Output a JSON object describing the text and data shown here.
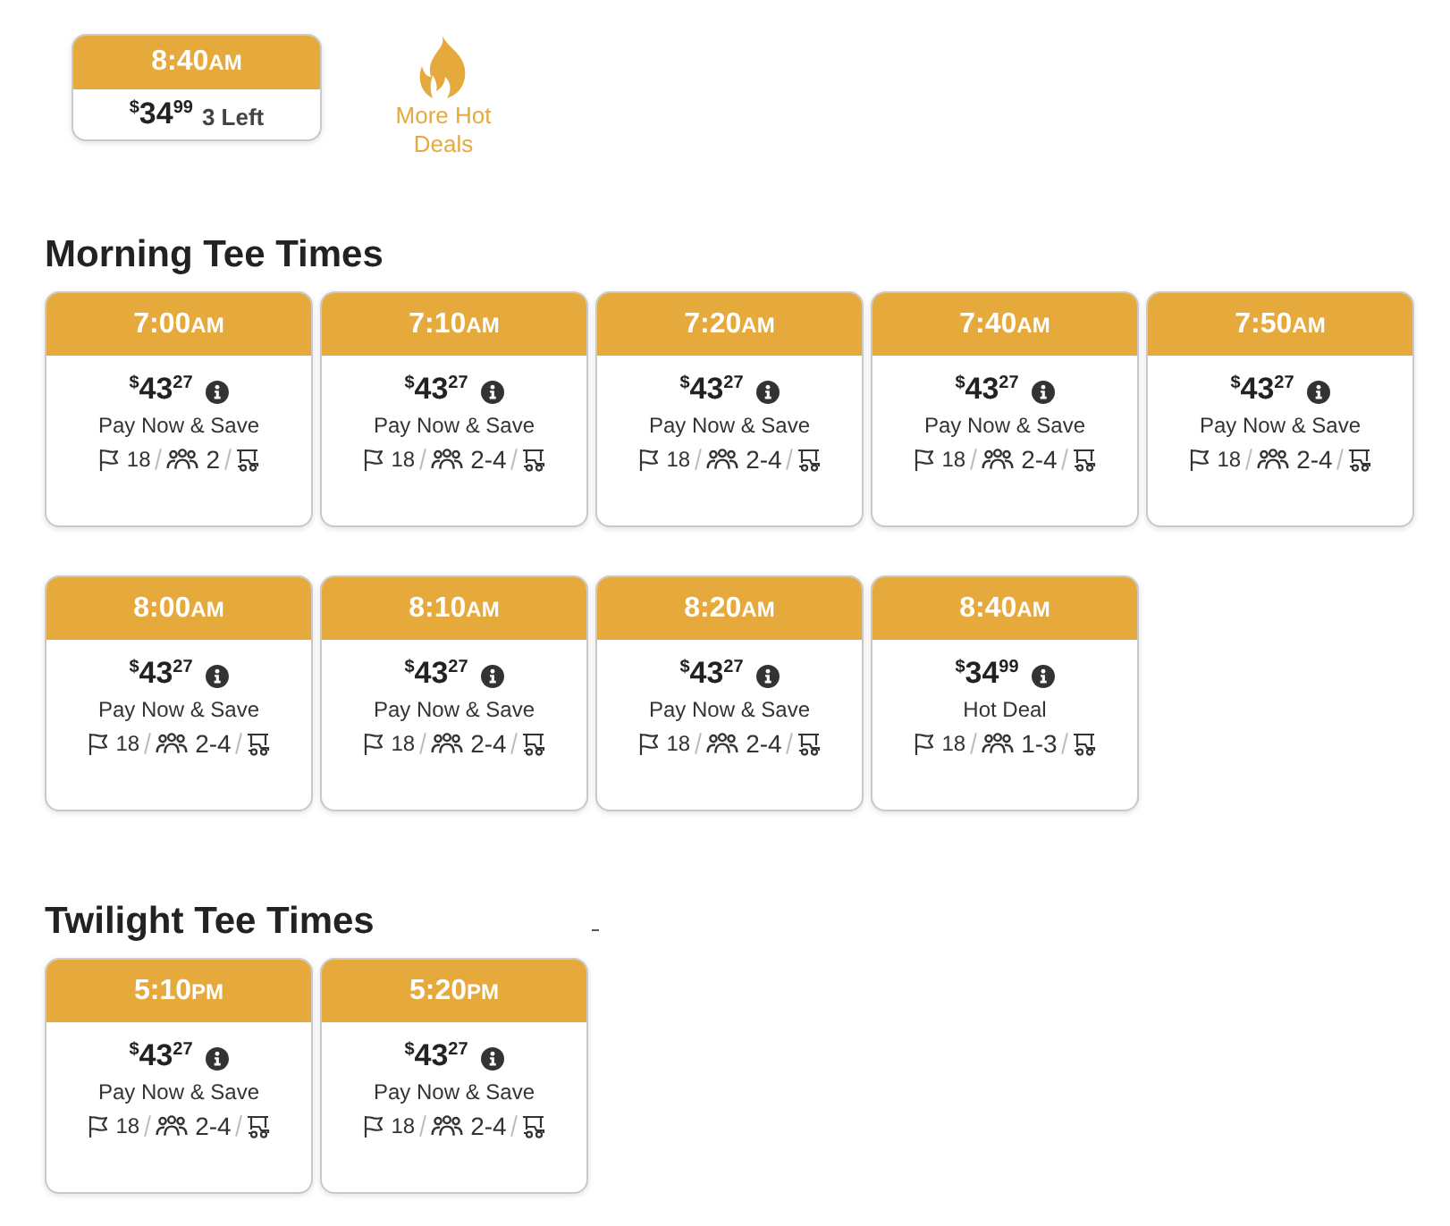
{
  "hot_deal_banner": {
    "time": "8:40",
    "period": "AM",
    "price": "$^{$}$34$^{99}$",
    "availability": "3 Left"
  },
  "more_hot_deals": {
    "label": "More Hot Deals"
  },
  "sections": [
    {
      "title": "Morning Tee Times",
      "tee_times": [
        {
          "time": "7:00",
          "period": "AM",
          "price": "$^{$}$43$^{27}$",
          "rate_label": "Pay Now & Save",
          "holes": "18",
          "players": "2"
        },
        {
          "time": "7:10",
          "period": "AM",
          "price": "$^{$}$43$^{27}$",
          "rate_label": "Pay Now & Save",
          "holes": "18",
          "players": "2-4"
        },
        {
          "time": "7:20",
          "period": "AM",
          "price": "$^{$}$43$^{27}$",
          "rate_label": "Pay Now & Save",
          "holes": "18",
          "players": "2-4"
        },
        {
          "time": "7:40",
          "period": "AM",
          "price": "$^{$}$43$^{27}$",
          "rate_label": "Pay Now & Save",
          "holes": "18",
          "players": "2-4"
        },
        {
          "time": "7:50",
          "period": "AM",
          "price": "$^{$}$43$^{27}$",
          "rate_label": "Pay Now & Save",
          "holes": "18",
          "players": "2-4"
        },
        {
          "time": "8:00",
          "period": "AM",
          "price": "$^{$}$43$^{27}$",
          "rate_label": "Pay Now & Save",
          "holes": "18",
          "players": "2-4"
        },
        {
          "time": "8:10",
          "period": "AM",
          "price": "$^{$}$43$^{27}$",
          "rate_label": "Pay Now & Save",
          "holes": "18",
          "players": "2-4"
        },
        {
          "time": "8:20",
          "period": "AM",
          "price": "$^{$}$43$^{27}$",
          "rate_label": "Pay Now & Save",
          "holes": "18",
          "players": "2-4"
        },
        {
          "time": "8:40",
          "period": "AM",
          "price": "$^{$}$34$^{99}$",
          "rate_label": "Hot Deal",
          "holes": "18",
          "players": "1-3"
        }
      ]
    },
    {
      "title": "Twilight Tee Times",
      "tee_times": [
        {
          "time": "5:10",
          "period": "PM",
          "price": "$^{$}$43$^{27}$",
          "rate_label": "Pay Now & Save",
          "holes": "18",
          "players": "2-4"
        },
        {
          "time": "5:20",
          "period": "PM",
          "price": "$^{$}$43$^{27}$",
          "rate_label": "Pay Now & Save",
          "holes": "18",
          "players": "2-4"
        }
      ]
    }
  ]
}
